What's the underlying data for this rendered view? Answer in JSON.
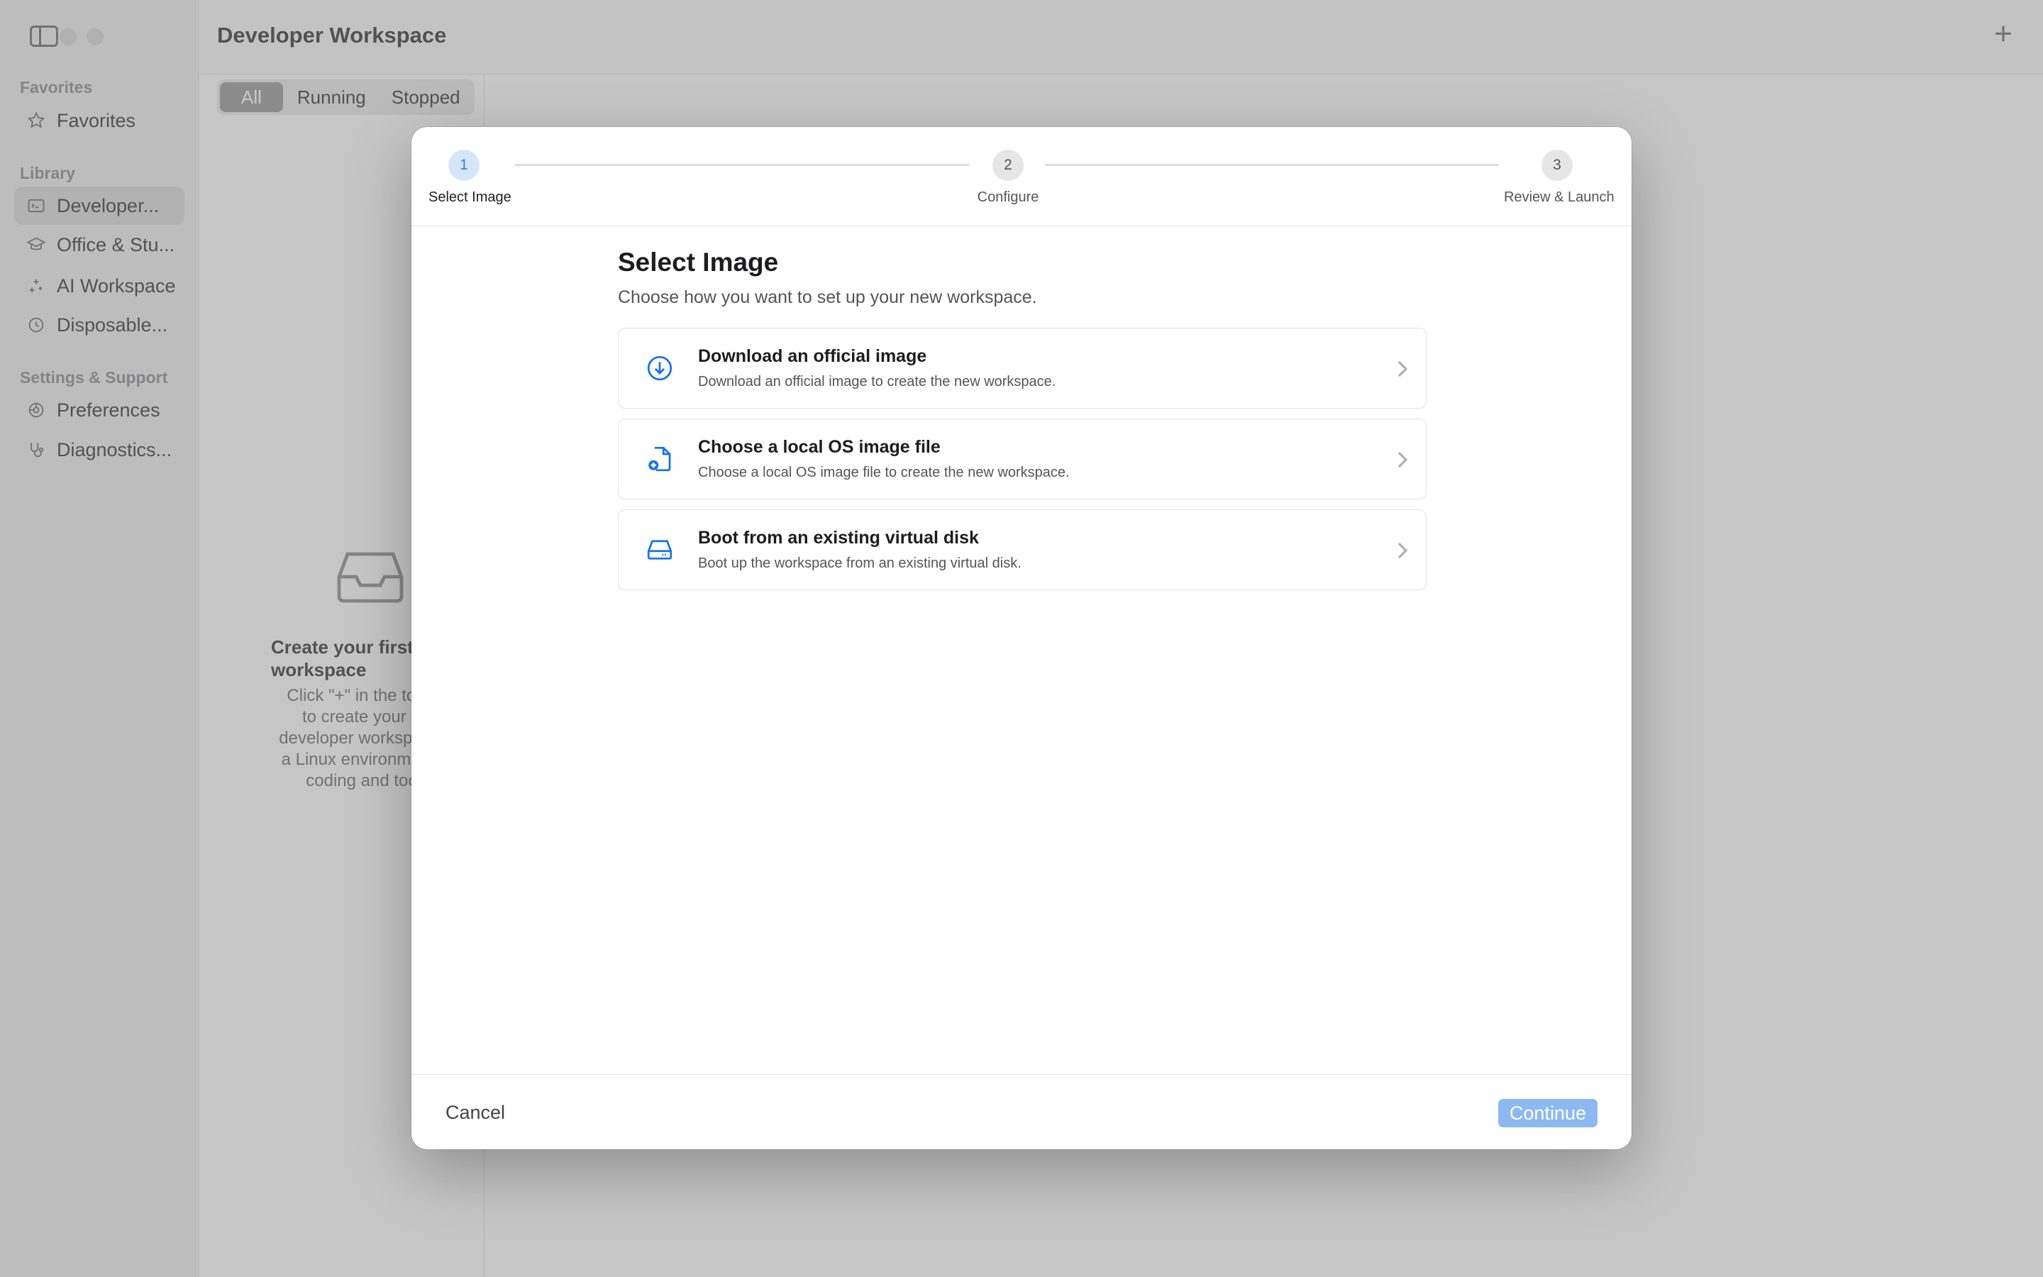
{
  "window": {
    "title": "Developer Workspace"
  },
  "sidebar": {
    "sections": [
      {
        "label": "Favorites"
      },
      {
        "label": "Library"
      },
      {
        "label": "Settings & Support"
      }
    ],
    "items": [
      {
        "label": "Favorites",
        "icon": "star-icon"
      },
      {
        "label": "Developer...",
        "icon": "terminal-window-icon",
        "active": true
      },
      {
        "label": "Office & Stu...",
        "icon": "graduation-cap-icon"
      },
      {
        "label": "AI Workspace",
        "icon": "sparkles-icon"
      },
      {
        "label": "Disposable...",
        "icon": "timer-icon"
      },
      {
        "label": "Preferences",
        "icon": "settings-icon"
      },
      {
        "label": "Diagnostics...",
        "icon": "stethoscope-icon"
      }
    ]
  },
  "toolbar": {
    "add_label": "+"
  },
  "filter": {
    "tabs": [
      "All",
      "Running",
      "Stopped"
    ],
    "selected": "All"
  },
  "empty_state": {
    "title": "Create your first workspace",
    "body": "Click \"+\" in the toolbar to create your first developer workspace — a Linux environment for coding and tools."
  },
  "wizard": {
    "steps": [
      {
        "number": "1",
        "label": "Select Image",
        "active": true
      },
      {
        "number": "2",
        "label": "Configure"
      },
      {
        "number": "3",
        "label": "Review & Launch"
      }
    ],
    "heading": "Select Image",
    "subheading": "Choose how you want to set up your new workspace.",
    "options": [
      {
        "title": "Download an official image",
        "description": "Download an official image to create the new workspace.",
        "icon": "download-circle-icon"
      },
      {
        "title": "Choose a local OS image file",
        "description": "Choose a local OS image file to create the new workspace.",
        "icon": "document-add-icon"
      },
      {
        "title": "Boot from an existing virtual disk",
        "description": "Boot up the workspace from an existing virtual disk.",
        "icon": "disk-drive-icon"
      }
    ],
    "cancel_label": "Cancel",
    "continue_label": "Continue"
  },
  "colors": {
    "accent": "#1a73e8",
    "continue_button": "#8db8f2",
    "step_active": "#d6e6fa"
  }
}
